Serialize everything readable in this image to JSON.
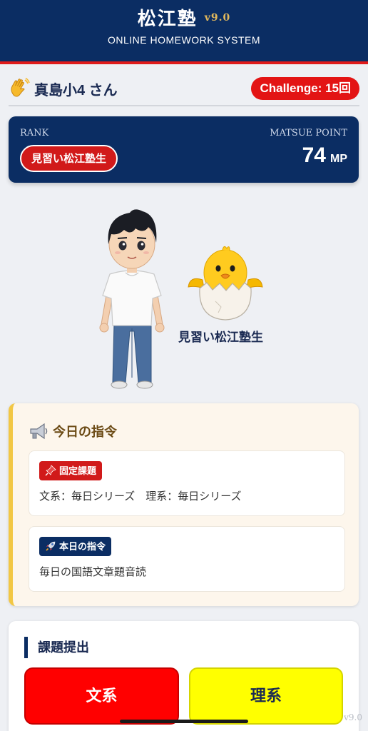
{
  "header": {
    "title": "松江塾",
    "version": "v9.0",
    "subtitle": "ONLINE HOMEWORK SYSTEM"
  },
  "user": {
    "name": "真島小4 さん",
    "challenge": "Challenge: 15回",
    "icon": "waving-hand-icon"
  },
  "rank_card": {
    "rank_label": "RANK",
    "rank_name": "見習い松江塾生",
    "point_label": "MATSUE POINT",
    "point_value": "74",
    "point_unit": "MP"
  },
  "avatar": {
    "caption": "見習い松江塾生",
    "figures": [
      "boy-avatar",
      "hatching-chick-icon"
    ]
  },
  "mission": {
    "title": "今日の指令",
    "icon": "megaphone-icon",
    "fixed": {
      "tag": "固定課題",
      "tag_icon": "pushpin-icon",
      "text": "文系：毎日シリーズ　理系：毎日シリーズ"
    },
    "today": {
      "tag": "本日の指令",
      "tag_icon": "rocket-icon",
      "text": "毎日の国語文章題音読"
    }
  },
  "submission": {
    "title": "課題提出",
    "bunkei": "文系",
    "rikei": "理系"
  },
  "footer": {
    "version": "v9.0"
  },
  "colors": {
    "navy": "#0b2d63",
    "red": "#e31414",
    "yellow": "#ffff00",
    "gold": "#f2c744"
  }
}
